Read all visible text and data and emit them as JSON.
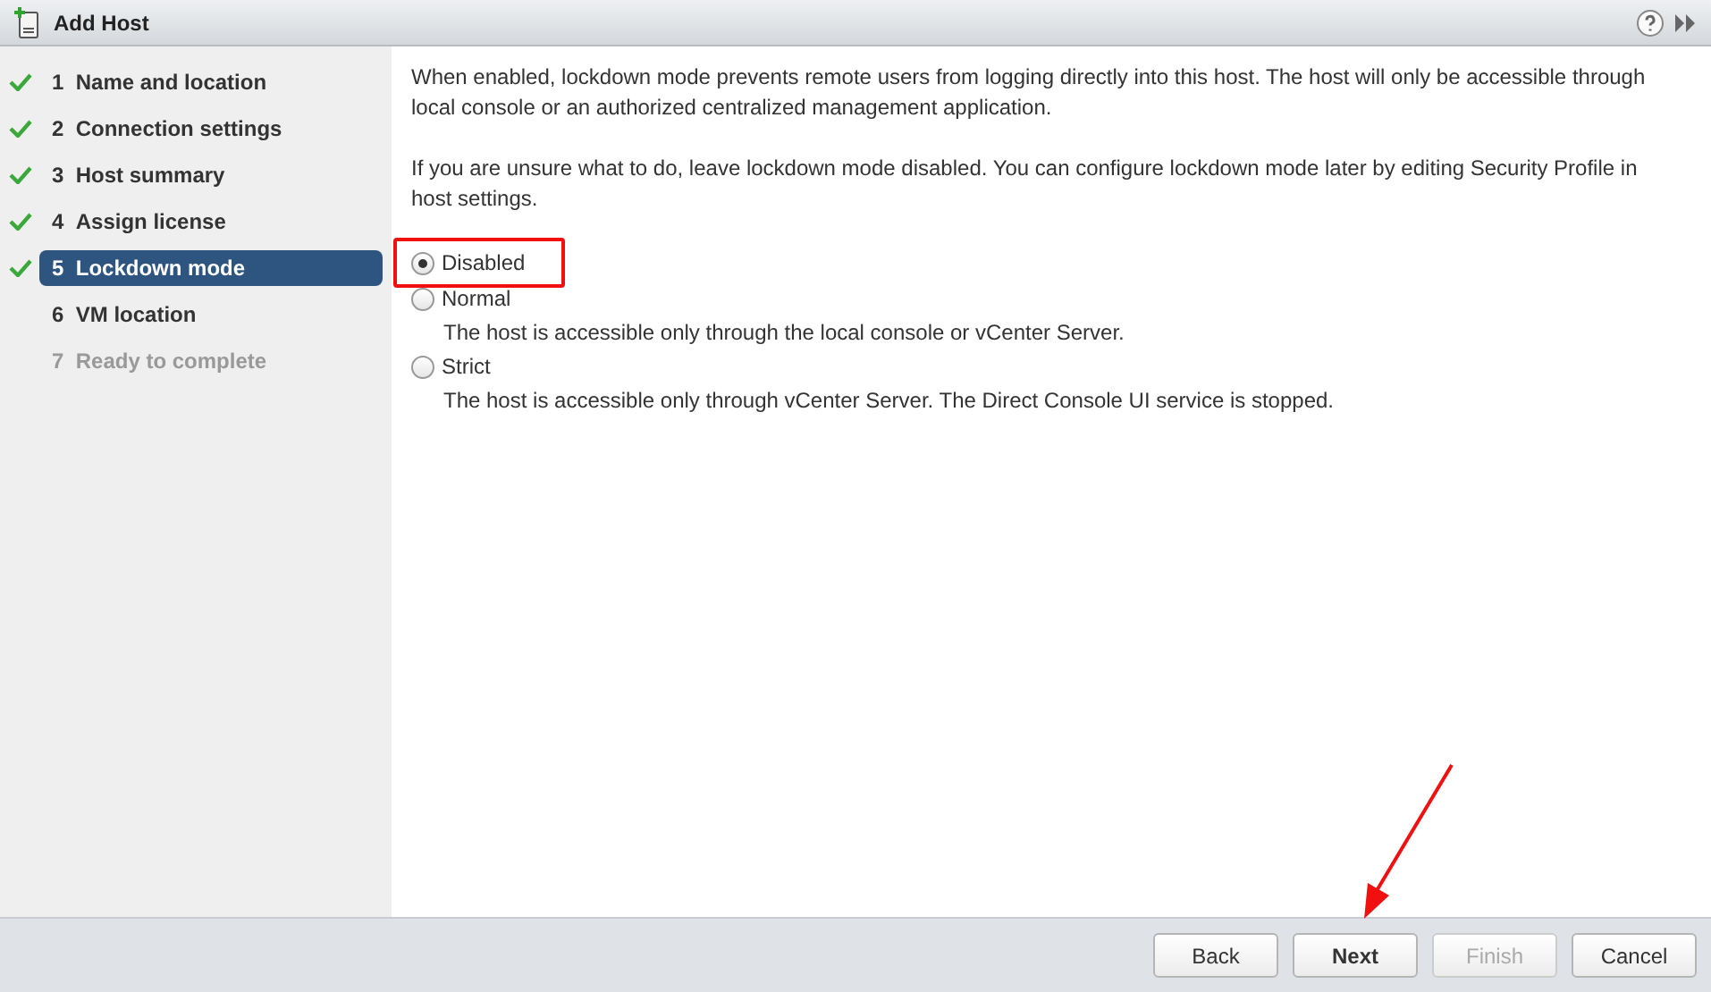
{
  "window": {
    "title": "Add Host"
  },
  "steps": [
    {
      "number": "1",
      "label": "Name and location",
      "done": true,
      "selected": false,
      "disabled": false
    },
    {
      "number": "2",
      "label": "Connection settings",
      "done": true,
      "selected": false,
      "disabled": false
    },
    {
      "number": "3",
      "label": "Host summary",
      "done": true,
      "selected": false,
      "disabled": false
    },
    {
      "number": "4",
      "label": "Assign license",
      "done": true,
      "selected": false,
      "disabled": false
    },
    {
      "number": "5",
      "label": "Lockdown mode",
      "done": true,
      "selected": true,
      "disabled": false
    },
    {
      "number": "6",
      "label": "VM location",
      "done": false,
      "selected": false,
      "disabled": false
    },
    {
      "number": "7",
      "label": "Ready to complete",
      "done": false,
      "selected": false,
      "disabled": true
    }
  ],
  "intro": [
    "When enabled, lockdown mode prevents remote users from logging directly into this host. The host will only be accessible through local console or an authorized centralized management application.",
    "If you are unsure what to do, leave lockdown mode disabled. You can configure lockdown mode later by editing Security Profile in host settings."
  ],
  "options": [
    {
      "label": "Disabled",
      "selected": true,
      "highlighted": true
    },
    {
      "label": "Normal",
      "selected": false,
      "highlighted": false,
      "description": "The host is accessible only through the local console or vCenter Server."
    },
    {
      "label": "Strict",
      "selected": false,
      "highlighted": false,
      "description": "The host is accessible only through vCenter Server. The Direct Console UI service is stopped."
    }
  ],
  "buttons": [
    {
      "label": "Back",
      "disabled": false,
      "primary": false,
      "pointed_at": false
    },
    {
      "label": "Next",
      "disabled": false,
      "primary": true,
      "pointed_at": true
    },
    {
      "label": "Finish",
      "disabled": true,
      "primary": false,
      "pointed_at": false
    },
    {
      "label": "Cancel",
      "disabled": false,
      "primary": false,
      "pointed_at": false
    }
  ]
}
